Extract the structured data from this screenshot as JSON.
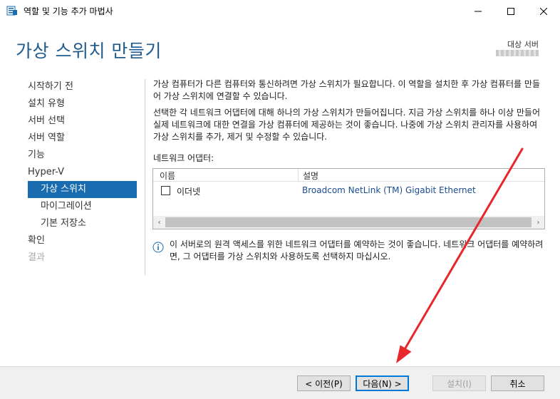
{
  "window": {
    "title": "역할 및 기능 추가 마법사",
    "icon": "server-manager-icon"
  },
  "header": {
    "title": "가상 스위치 만들기",
    "target_label": "대상 서버"
  },
  "nav": {
    "items": [
      {
        "label": "시작하기 전"
      },
      {
        "label": "설치 유형"
      },
      {
        "label": "서버 선택"
      },
      {
        "label": "서버 역할"
      },
      {
        "label": "기능"
      },
      {
        "label": "Hyper-V"
      },
      {
        "label": "가상 스위치",
        "active": true
      },
      {
        "label": "마이그레이션"
      },
      {
        "label": "기본 저장소"
      },
      {
        "label": "확인"
      },
      {
        "label": "결과",
        "disabled": true
      }
    ]
  },
  "main": {
    "paragraph1": "가상 컴퓨터가 다른 컴퓨터와 통신하려면 가상 스위치가 필요합니다. 이 역할을 설치한 후 가상 컴퓨터를 만들어 가상 스위치에 연결할 수 있습니다.",
    "paragraph2": "선택한 각 네트워크 어댑터에 대해 하나의 가상 스위치가 만들어집니다. 지금 가상 스위치를 하나 이상 만들어 실제 네트워크에 대한 연결을 가상 컴퓨터에 제공하는 것이 좋습니다. 나중에 가상 스위치 관리자를 사용하여 가상 스위치를 추가, 제거 및 수정할 수 있습니다.",
    "adapters_label": "네트워크 어댑터:",
    "table": {
      "columns": [
        "이름",
        "설명"
      ],
      "rows": [
        {
          "name": "이더넷",
          "description": "Broadcom NetLink (TM) Gigabit Ethernet",
          "checked": false
        }
      ]
    },
    "info_text": "이 서버로의 원격 액세스를 위한 네트워크 어댑터를 예약하는 것이 좋습니다. 네트워크 어댑터를 예약하려면, 그 어댑터를 가상 스위치와 사용하도록 선택하지 마십시오."
  },
  "footer": {
    "prev_label": "< 이전(P)",
    "next_label": "다음(N) >",
    "install_label": "설치(I)",
    "cancel_label": "취소"
  },
  "colors": {
    "title_blue": "#1f5b8c",
    "nav_active": "#1a6cb0",
    "annotation_arrow": "#e8262b"
  }
}
